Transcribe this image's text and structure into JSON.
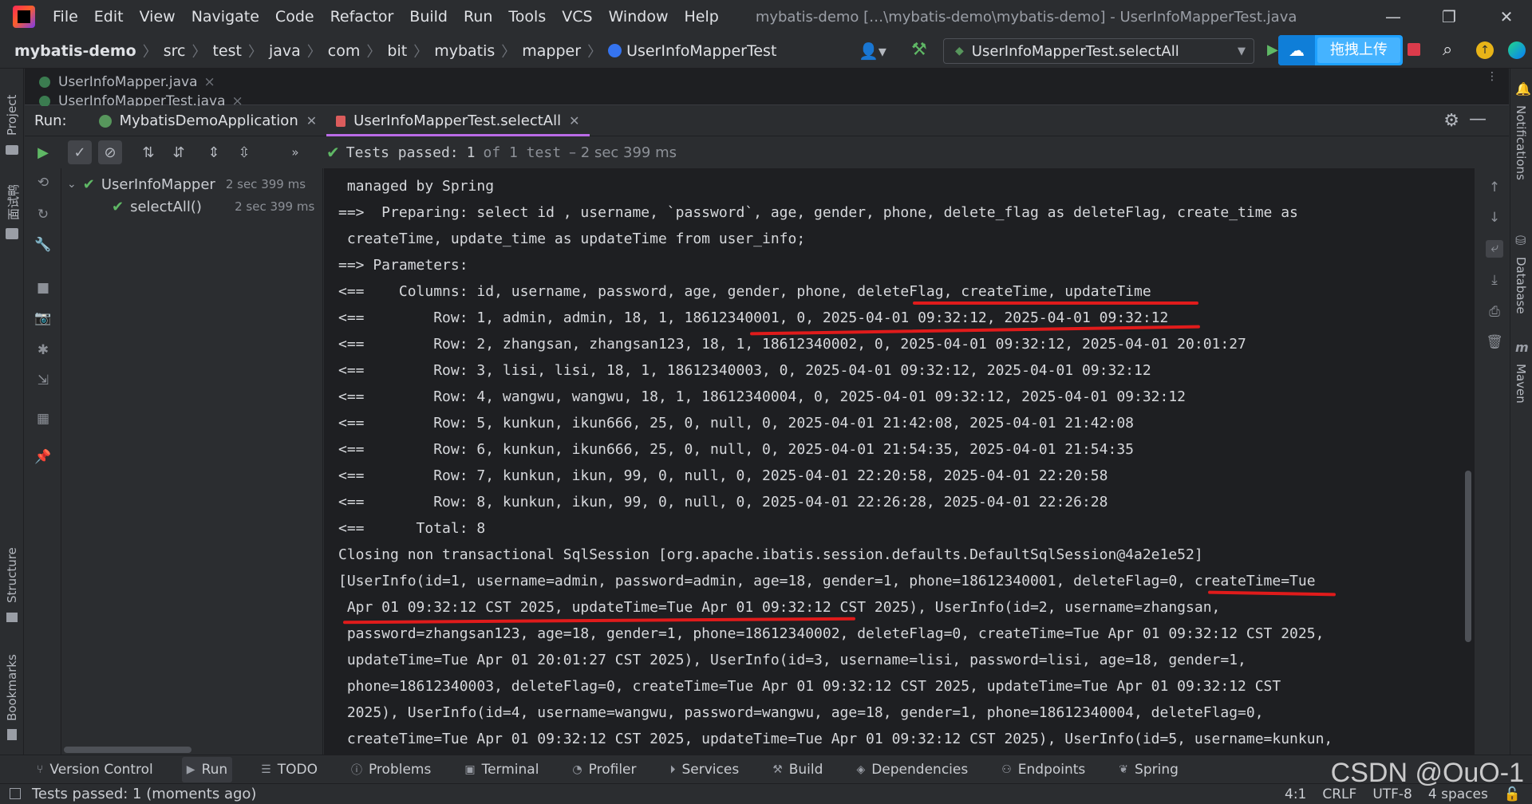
{
  "titlebar": {
    "menu": [
      "File",
      "Edit",
      "View",
      "Navigate",
      "Code",
      "Refactor",
      "Build",
      "Run",
      "Tools",
      "VCS",
      "Window",
      "Help"
    ],
    "window_title": "mybatis-demo […\\mybatis-demo\\mybatis-demo] - UserInfoMapperTest.java"
  },
  "breadcrumb": {
    "items": [
      "mybatis-demo",
      "src",
      "test",
      "java",
      "com",
      "bit",
      "mybatis",
      "mapper"
    ],
    "current": "UserInfoMapperTest"
  },
  "run_config": {
    "label": "UserInfoMapperTest.selectAll"
  },
  "upload_widget": {
    "label": "拖拽上传"
  },
  "left_strip": {
    "project_label": "Project",
    "interview_label": "面试鸭",
    "structure_label": "Structure",
    "bookmarks_label": "Bookmarks"
  },
  "right_strip": {
    "notifications_label": "Notifications",
    "database_label": "Database",
    "maven_label": "Maven"
  },
  "editor_tabs": [
    "UserInfoMapper.java",
    "UserInfoMapperTest.java"
  ],
  "run_panel": {
    "label": "Run:",
    "tabs": [
      {
        "label": "MybatisDemoApplication"
      },
      {
        "label": "UserInfoMapperTest.selectAll"
      }
    ]
  },
  "test_status": {
    "prefix": "Tests passed:",
    "count": "1",
    "suffix": "of 1 test",
    "duration": "– 2 sec 399 ms"
  },
  "test_tree": [
    {
      "label": "UserInfoMapper",
      "duration": "2 sec 399 ms"
    },
    {
      "label": "selectAll()",
      "duration": "2 sec 399 ms"
    }
  ],
  "console_lines": [
    " managed by Spring",
    "==>  Preparing: select id , username, `password`, age, gender, phone, delete_flag as deleteFlag, create_time as",
    " createTime, update_time as updateTime from user_info;",
    "==> Parameters: ",
    "<==    Columns: id, username, password, age, gender, phone, deleteFlag, createTime, updateTime",
    "<==        Row: 1, admin, admin, 18, 1, 18612340001, 0, 2025-04-01 09:32:12, 2025-04-01 09:32:12",
    "<==        Row: 2, zhangsan, zhangsan123, 18, 1, 18612340002, 0, 2025-04-01 09:32:12, 2025-04-01 20:01:27",
    "<==        Row: 3, lisi, lisi, 18, 1, 18612340003, 0, 2025-04-01 09:32:12, 2025-04-01 09:32:12",
    "<==        Row: 4, wangwu, wangwu, 18, 1, 18612340004, 0, 2025-04-01 09:32:12, 2025-04-01 09:32:12",
    "<==        Row: 5, kunkun, ikun666, 25, 0, null, 0, 2025-04-01 21:42:08, 2025-04-01 21:42:08",
    "<==        Row: 6, kunkun, ikun666, 25, 0, null, 0, 2025-04-01 21:54:35, 2025-04-01 21:54:35",
    "<==        Row: 7, kunkun, ikun, 99, 0, null, 0, 2025-04-01 22:20:58, 2025-04-01 22:20:58",
    "<==        Row: 8, kunkun, ikun, 99, 0, null, 0, 2025-04-01 22:26:28, 2025-04-01 22:26:28",
    "<==      Total: 8",
    "Closing non transactional SqlSession [org.apache.ibatis.session.defaults.DefaultSqlSession@4a2e1e52]",
    "[UserInfo(id=1, username=admin, password=admin, age=18, gender=1, phone=18612340001, deleteFlag=0, createTime=Tue",
    " Apr 01 09:32:12 CST 2025, updateTime=Tue Apr 01 09:32:12 CST 2025), UserInfo(id=2, username=zhangsan,",
    " password=zhangsan123, age=18, gender=1, phone=18612340002, deleteFlag=0, createTime=Tue Apr 01 09:32:12 CST 2025,",
    " updateTime=Tue Apr 01 20:01:27 CST 2025), UserInfo(id=3, username=lisi, password=lisi, age=18, gender=1,",
    " phone=18612340003, deleteFlag=0, createTime=Tue Apr 01 09:32:12 CST 2025, updateTime=Tue Apr 01 09:32:12 CST",
    " 2025), UserInfo(id=4, username=wangwu, password=wangwu, age=18, gender=1, phone=18612340004, deleteFlag=0,",
    " createTime=Tue Apr 01 09:32:12 CST 2025, updateTime=Tue Apr 01 09:32:12 CST 2025), UserInfo(id=5, username=kunkun,"
  ],
  "bottom_tools": [
    "Version Control",
    "Run",
    "TODO",
    "Problems",
    "Terminal",
    "Profiler",
    "Services",
    "Build",
    "Dependencies",
    "Endpoints",
    "Spring"
  ],
  "statusbar": {
    "text": "Tests passed: 1 (moments ago)",
    "position": "4:1",
    "line_sep": "CRLF",
    "encoding": "UTF-8",
    "indent": "4 spaces"
  },
  "watermark": "CSDN @OuO-1",
  "colors": {
    "accent_purple": "#b96be6",
    "pass_green": "#5fb865",
    "annotation_red": "#e01b1b"
  }
}
